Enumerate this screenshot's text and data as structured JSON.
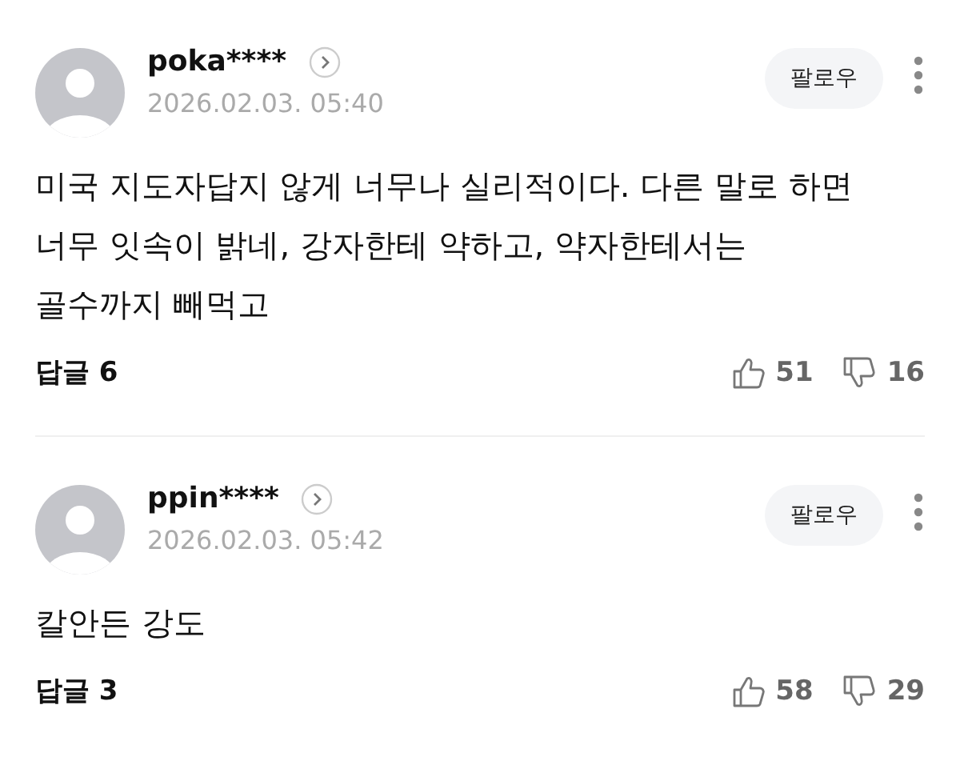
{
  "comments": [
    {
      "author": "poka****",
      "date": "2026.02.03. 05:40",
      "follow_label": "팔로우",
      "text": "미국 지도자답지 않게 너무나 실리적이다. 다른 말로 하면 너무 잇속이 밝네, 강자한테 약하고, 약자한테서는 골수까지 빼먹고",
      "replies": "답글 6",
      "likes": "51",
      "dislikes": "16"
    },
    {
      "author": "ppin****",
      "date": "2026.02.03. 05:42",
      "follow_label": "팔로우",
      "text": "칼안든 강도",
      "replies": "답글 3",
      "likes": "58",
      "dislikes": "29"
    }
  ]
}
